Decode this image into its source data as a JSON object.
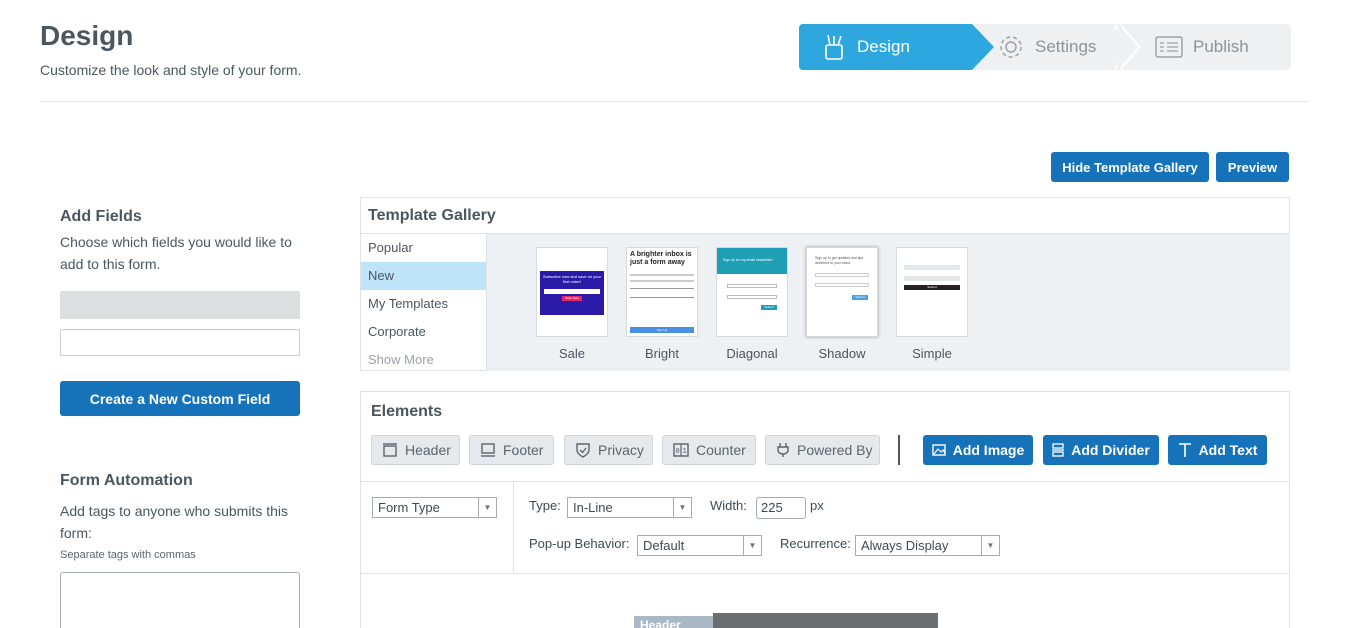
{
  "header": {
    "title": "Design",
    "subtitle": "Customize the look and style of your form."
  },
  "stepper": {
    "steps": [
      {
        "label": "Design",
        "state": "active",
        "icon": "design-tools-icon"
      },
      {
        "label": "Settings",
        "state": "inactive",
        "icon": "gear-icon"
      },
      {
        "label": "Publish",
        "state": "inactive",
        "icon": "publish-list-icon"
      }
    ]
  },
  "toolbar": {
    "hide_gallery_label": "Hide Template Gallery",
    "preview_label": "Preview"
  },
  "add_fields": {
    "heading": "Add Fields",
    "description": "Choose which fields you would like to add to this form.",
    "create_button": "Create a New Custom Field"
  },
  "automation": {
    "heading": "Form Automation",
    "description": "Add tags to anyone who submits this form:",
    "note": "Separate tags with commas"
  },
  "gallery": {
    "title": "Template Gallery",
    "categories": [
      {
        "label": "Popular"
      },
      {
        "label": "New",
        "active": true
      },
      {
        "label": "My Templates"
      },
      {
        "label": "Corporate"
      },
      {
        "label": "Show More"
      }
    ],
    "templates": [
      {
        "label": "Sale",
        "thumb_title": "Subscribe now and save on your first order!",
        "thumb_button": "Save Now",
        "accent": "#2b1aa8"
      },
      {
        "label": "Bright",
        "thumb_title": "A brighter inbox is just a form away",
        "thumb_button": "Sign Up",
        "accent": "#4a90e2"
      },
      {
        "label": "Diagonal",
        "thumb_title": "Sign up for my email newsletter!",
        "thumb_button": "Submit",
        "accent": "#1f9fb4"
      },
      {
        "label": "Shadow",
        "thumb_title": "Sign up to get updates and tips delivered to your inbox.",
        "thumb_button": "Submit",
        "accent": "#4aa3e0"
      },
      {
        "label": "Simple",
        "thumb_title": "",
        "thumb_button": "Submit",
        "accent": "#222222"
      }
    ]
  },
  "elements": {
    "title": "Elements",
    "toggles": [
      {
        "label": "Header",
        "icon": "header-icon"
      },
      {
        "label": "Footer",
        "icon": "footer-icon"
      },
      {
        "label": "Privacy",
        "icon": "shield-check-icon"
      },
      {
        "label": "Counter",
        "icon": "counter-icon"
      },
      {
        "label": "Powered By",
        "icon": "plug-icon"
      }
    ],
    "actions": [
      {
        "label": "Add Image",
        "icon": "image-icon"
      },
      {
        "label": "Add Divider",
        "icon": "divider-icon"
      },
      {
        "label": "Add Text",
        "icon": "text-icon"
      }
    ],
    "form_type": "Form Type",
    "type_label": "Type:",
    "type_value": "In-Line",
    "width_label": "Width:",
    "width_value": "225",
    "width_unit": "px",
    "popup_label": "Pop-up Behavior:",
    "popup_value": "Default",
    "recurrence_label": "Recurrence:",
    "recurrence_value": "Always Display"
  },
  "preview": {
    "header_tag": "Header"
  },
  "colors": {
    "accent": "#2ea7de",
    "primary_button": "#1673b9",
    "active_category": "#bfe3f8"
  }
}
